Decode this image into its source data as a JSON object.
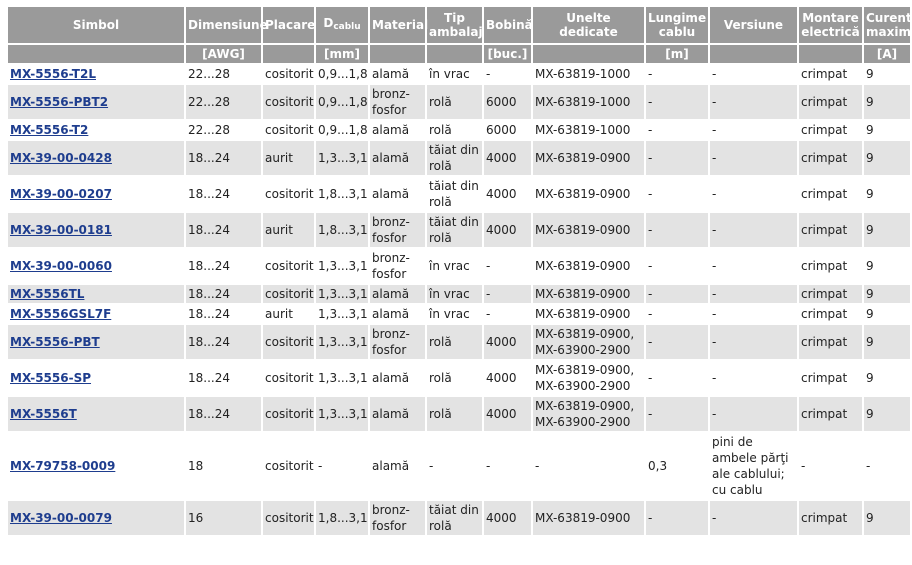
{
  "headers": {
    "simbol": "Simbol",
    "dimensiune": "Dimensiune",
    "placare": "Placare",
    "dcablu_main": "D",
    "dcablu_sub": "cablu",
    "material": "Material",
    "tip_ambalaj": "Tip ambalaj",
    "bobina": "Bobină",
    "unelte": "Unelte dedicate",
    "lungime": "Lungime cablu",
    "versiune": "Versiune",
    "montare": "Montare electrică",
    "curent": "Curent maxim"
  },
  "units": {
    "dimensiune": "[AWG]",
    "dcablu": "[mm]",
    "bobina": "[buc.]",
    "lungime": "[m]",
    "curent": "[A]"
  },
  "rows": [
    {
      "simbol": "MX-5556-T2L",
      "dim": "22...28",
      "placare": "cositorit",
      "dcablu": "0,9...1,8",
      "material": "alamă",
      "ambalaj": "în vrac",
      "bobina": "-",
      "unelte": "MX-63819-1000",
      "lungime": "-",
      "versiune": "-",
      "montare": "crimpat",
      "curent": "9"
    },
    {
      "simbol": "MX-5556-PBT2",
      "dim": "22...28",
      "placare": "cositorit",
      "dcablu": "0,9...1,8",
      "material": "bronz-fosfor",
      "ambalaj": "rolă",
      "bobina": "6000",
      "unelte": "MX-63819-1000",
      "lungime": "-",
      "versiune": "-",
      "montare": "crimpat",
      "curent": "9"
    },
    {
      "simbol": "MX-5556-T2",
      "dim": "22...28",
      "placare": "cositorit",
      "dcablu": "0,9...1,8",
      "material": "alamă",
      "ambalaj": "rolă",
      "bobina": "6000",
      "unelte": "MX-63819-1000",
      "lungime": "-",
      "versiune": "-",
      "montare": "crimpat",
      "curent": "9"
    },
    {
      "simbol": "MX-39-00-0428",
      "dim": "18...24",
      "placare": "aurit",
      "dcablu": "1,3...3,1",
      "material": "alamă",
      "ambalaj": "tăiat din rolă",
      "bobina": "4000",
      "unelte": "MX-63819-0900",
      "lungime": "-",
      "versiune": "-",
      "montare": "crimpat",
      "curent": "9"
    },
    {
      "simbol": "MX-39-00-0207",
      "dim": "18...24",
      "placare": "cositorit",
      "dcablu": "1,8...3,1",
      "material": "alamă",
      "ambalaj": "tăiat din rolă",
      "bobina": "4000",
      "unelte": "MX-63819-0900",
      "lungime": "-",
      "versiune": "-",
      "montare": "crimpat",
      "curent": "9"
    },
    {
      "simbol": "MX-39-00-0181",
      "dim": "18...24",
      "placare": "aurit",
      "dcablu": "1,8...3,1",
      "material": "bronz-fosfor",
      "ambalaj": "tăiat din rolă",
      "bobina": "4000",
      "unelte": "MX-63819-0900",
      "lungime": "-",
      "versiune": "-",
      "montare": "crimpat",
      "curent": "9"
    },
    {
      "simbol": "MX-39-00-0060",
      "dim": "18...24",
      "placare": "cositorit",
      "dcablu": "1,3...3,1",
      "material": "bronz-fosfor",
      "ambalaj": "în vrac",
      "bobina": "-",
      "unelte": "MX-63819-0900",
      "lungime": "-",
      "versiune": "-",
      "montare": "crimpat",
      "curent": "9"
    },
    {
      "simbol": "MX-5556TL",
      "dim": "18...24",
      "placare": "cositorit",
      "dcablu": "1,3...3,1",
      "material": "alamă",
      "ambalaj": "în vrac",
      "bobina": "-",
      "unelte": "MX-63819-0900",
      "lungime": "-",
      "versiune": "-",
      "montare": "crimpat",
      "curent": "9"
    },
    {
      "simbol": "MX-5556GSL7F",
      "dim": "18...24",
      "placare": "aurit",
      "dcablu": "1,3...3,1",
      "material": "alamă",
      "ambalaj": "în vrac",
      "bobina": "-",
      "unelte": "MX-63819-0900",
      "lungime": "-",
      "versiune": "-",
      "montare": "crimpat",
      "curent": "9"
    },
    {
      "simbol": "MX-5556-PBT",
      "dim": "18...24",
      "placare": "cositorit",
      "dcablu": "1,3...3,1",
      "material": "bronz-fosfor",
      "ambalaj": "rolă",
      "bobina": "4000",
      "unelte": "MX-63819-0900, MX-63900-2900",
      "lungime": "-",
      "versiune": "-",
      "montare": "crimpat",
      "curent": "9"
    },
    {
      "simbol": "MX-5556-SP",
      "dim": "18...24",
      "placare": "cositorit",
      "dcablu": "1,3...3,1",
      "material": "alamă",
      "ambalaj": "rolă",
      "bobina": "4000",
      "unelte": "MX-63819-0900, MX-63900-2900",
      "lungime": "-",
      "versiune": "-",
      "montare": "crimpat",
      "curent": "9"
    },
    {
      "simbol": "MX-5556T",
      "dim": "18...24",
      "placare": "cositorit",
      "dcablu": "1,3...3,1",
      "material": "alamă",
      "ambalaj": "rolă",
      "bobina": "4000",
      "unelte": "MX-63819-0900, MX-63900-2900",
      "lungime": "-",
      "versiune": "-",
      "montare": "crimpat",
      "curent": "9"
    },
    {
      "simbol": "MX-79758-0009",
      "dim": "18",
      "placare": "cositorit",
      "dcablu": "-",
      "material": "alamă",
      "ambalaj": "-",
      "bobina": "-",
      "unelte": "-",
      "lungime": "0,3",
      "versiune": "pini de ambele părţi ale cablului; cu cablu",
      "montare": "-",
      "curent": "-"
    },
    {
      "simbol": "MX-39-00-0079",
      "dim": "16",
      "placare": "cositorit",
      "dcablu": "1,8...3,1",
      "material": "bronz-fosfor",
      "ambalaj": "tăiat din rolă",
      "bobina": "4000",
      "unelte": "MX-63819-0900",
      "lungime": "-",
      "versiune": "-",
      "montare": "crimpat",
      "curent": "9"
    }
  ]
}
